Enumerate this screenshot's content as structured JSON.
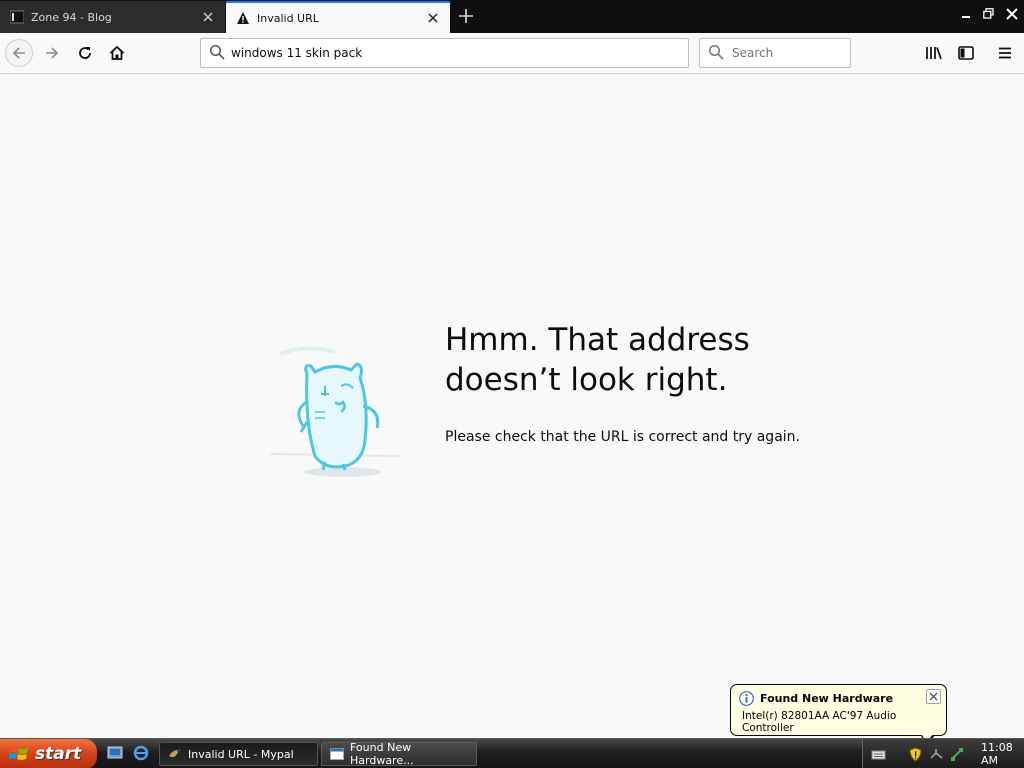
{
  "tabs": [
    {
      "label": "Zone 94 - Blog",
      "icon": "site-icon",
      "active": false
    },
    {
      "label": "Invalid URL",
      "icon": "warning-icon",
      "active": true
    }
  ],
  "navbar": {
    "url": "windows 11 skin pack",
    "search_placeholder": "Search"
  },
  "error_page": {
    "title_line1": "Hmm. That address",
    "title_line2": "doesn’t look right.",
    "description": "Please check that the URL is correct and try again."
  },
  "balloon": {
    "title": "Found New Hardware",
    "message": "Intel(r) 82801AA AC'97 Audio Controller"
  },
  "taskbar": {
    "start_label": "start",
    "tasks": [
      {
        "label": "Invalid URL - Mypal",
        "active": true
      },
      {
        "label": "Found New Hardware...",
        "active": false
      }
    ],
    "clock": "11:08 AM"
  },
  "colors": {
    "accent": "#0a84ff",
    "start_button": "#d2411a",
    "balloon_bg": "#ffffe1"
  }
}
